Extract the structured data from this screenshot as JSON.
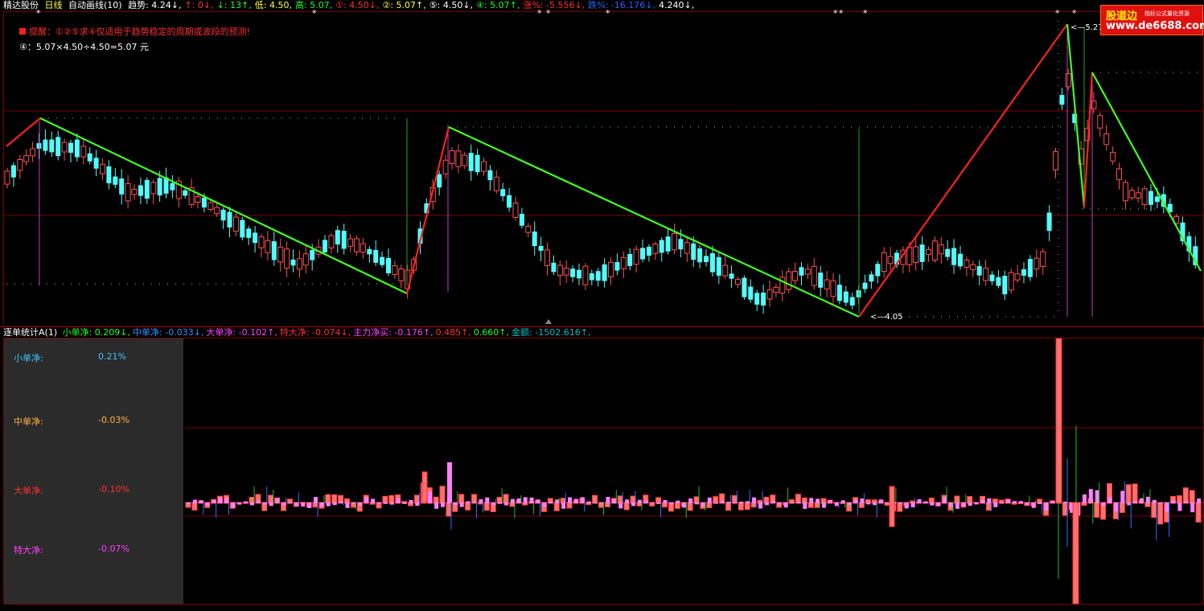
{
  "upper_header": {
    "stock_name": "精达股份",
    "period": "日线",
    "indicator": "自动画线(10)",
    "items": [
      {
        "label": "趋势",
        "value": "4.24",
        "arrow": "↓",
        "color": "#ffffff"
      },
      {
        "label": "↑",
        "value": "0",
        "arrow": "↓",
        "color": "#ff3030"
      },
      {
        "label": "↓",
        "value": "13",
        "arrow": "↑",
        "color": "#20ff20"
      },
      {
        "label": "低",
        "value": "4.50",
        "arrow": "",
        "color": "#ffff40"
      },
      {
        "label": "高",
        "value": "5.07",
        "arrow": "",
        "color": "#20ff20"
      },
      {
        "label": "①",
        "value": "4.50",
        "arrow": "↓",
        "color": "#ff3030"
      },
      {
        "label": "②",
        "value": "5.07",
        "arrow": "↑",
        "color": "#ffff40"
      },
      {
        "label": "⑤",
        "value": "4.50",
        "arrow": "↓",
        "color": "#ffffff"
      },
      {
        "label": "④",
        "value": "5.07",
        "arrow": "↑",
        "color": "#20ff20"
      },
      {
        "label": "涨%",
        "value": "-5.556",
        "arrow": "↓",
        "color": "#ff3030"
      },
      {
        "label": "跌%",
        "value": "-16.176",
        "arrow": "↓",
        "color": "#3060ff"
      },
      {
        "label": "",
        "value": "4.240",
        "arrow": "↓",
        "color": "#ffffff"
      }
    ]
  },
  "reminder": "提醒：①②⑤求④仅适用于趋势稳定的周期或波段的预测!",
  "formula": "④：5.07×4.50÷4.50=5.07 元",
  "price_labels": {
    "high": "5.27",
    "low": "4.05"
  },
  "logo": {
    "title": "股道边",
    "subtitle": "指标公式量化资源",
    "url": "www.de6688.com"
  },
  "lower_header": {
    "name": "逐单统计A(1)",
    "items": [
      {
        "label": "小单净",
        "value": "0.209",
        "arrow": "↓",
        "color": "#20ff20"
      },
      {
        "label": "中单净",
        "value": "-0.033",
        "arrow": "↓",
        "color": "#3090ff"
      },
      {
        "label": "大单净",
        "value": "-0.102",
        "arrow": "↑",
        "color": "#ff40ff"
      },
      {
        "label": "特大净",
        "value": "-0.074",
        "arrow": "↓",
        "color": "#ff3030"
      },
      {
        "label": "主力净买",
        "value": "-0.176",
        "arrow": "↑",
        "color": "#ff40ff"
      },
      {
        "label": "",
        "value": "0.485",
        "arrow": "↑",
        "color": "#ff3030"
      },
      {
        "label": "",
        "value": "0.660",
        "arrow": "↑",
        "color": "#20ff20"
      },
      {
        "label": "金额",
        "value": "-1502.616",
        "arrow": "↑",
        "color": "#00c0c0"
      }
    ]
  },
  "side_panel": [
    {
      "label": "小单净:",
      "value": "0.21%",
      "color": "#40c0ff"
    },
    {
      "label": "中单净:",
      "value": "-0.03%",
      "color": "#ffb040"
    },
    {
      "label": "大单净:",
      "value": "-0.10%",
      "color": "#ff3030"
    },
    {
      "label": "特大净:",
      "value": "-0.07%",
      "color": "#ff40ff"
    }
  ],
  "colors": {
    "up": "#ff5050",
    "down": "#50ffff",
    "trend_up": "#ff2020",
    "trend_down": "#40ff20",
    "grid": "#7a0000"
  }
}
